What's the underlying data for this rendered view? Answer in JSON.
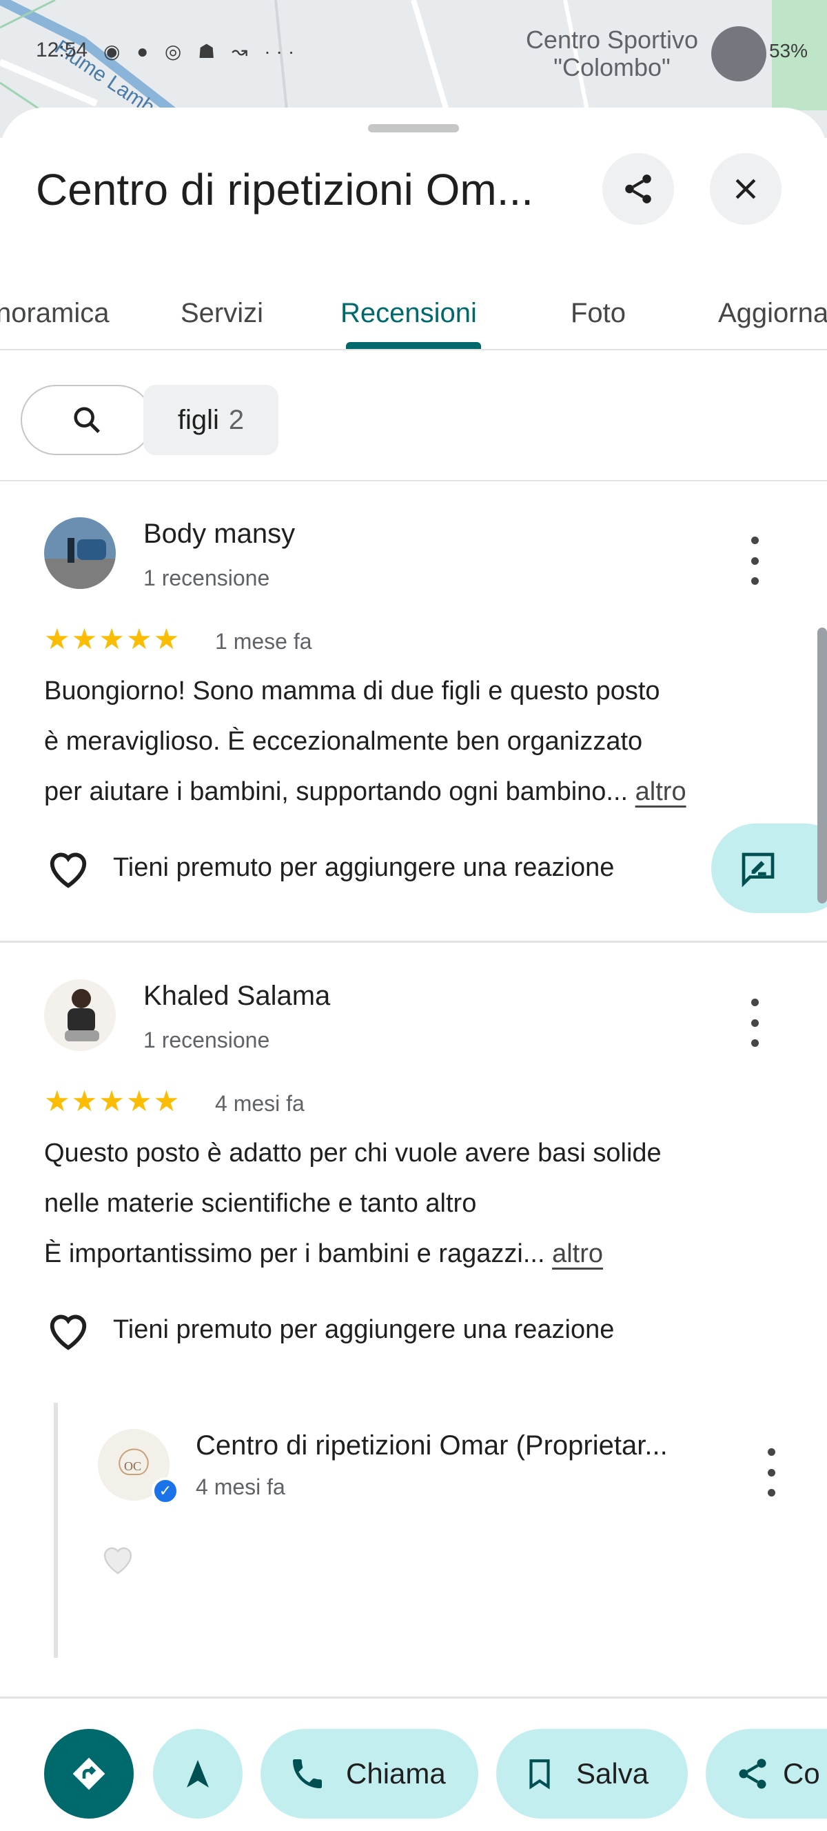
{
  "status_bar": {
    "time": "12:54",
    "notification_icons": "◉ ● ◎ ☗ ↝ ···",
    "battery": "53%"
  },
  "map": {
    "street_label": "Fiume Lamb",
    "place_label_line1": "Centro Sportivo",
    "place_label_line2": "\"Colombo\""
  },
  "header": {
    "title": "Centro di ripetizioni Om...",
    "share_icon": "share-icon",
    "close_icon": "close-icon"
  },
  "tabs": [
    {
      "label": "noramica"
    },
    {
      "label": "Servizi"
    },
    {
      "label": "Recensioni",
      "active": true
    },
    {
      "label": "Foto"
    },
    {
      "label": "Aggiorna"
    }
  ],
  "filters": {
    "search_icon": "search-icon",
    "chip_label": "figli",
    "chip_count": "2"
  },
  "reviews": [
    {
      "author": "Body mansy",
      "meta": "1 recensione",
      "rating": 5,
      "stars": "★★★★★",
      "when": "1 mese fa",
      "lines": [
        "Buongiorno! Sono mamma di due figli e questo posto",
        "è meraviglioso. È eccezionalmente ben organizzato",
        "per aiutare i bambini, supportando ogni bambino... "
      ],
      "more": "altro",
      "reaction": "Tieni premuto per aggiungere una reazione"
    },
    {
      "author": "Khaled Salama",
      "meta": "1 recensione",
      "rating": 5,
      "stars": "★★★★★",
      "when": "4 mesi fa",
      "lines": [
        "Questo posto è adatto per chi vuole avere basi solide",
        "nelle materie scientifiche e tanto altro",
        "È importantissimo per i bambini e ragazzi... "
      ],
      "more": "altro",
      "reaction": "Tieni premuto per aggiungere una reazione"
    }
  ],
  "owner_reply": {
    "name": "Centro di ripetizioni Omar (Proprietar...",
    "when": "4 mesi fa",
    "verified_icon": "verified-check-icon"
  },
  "bottom_actions": {
    "directions_icon": "directions-icon",
    "navigate_icon": "navigation-arrow-icon",
    "call": "Chiama",
    "save": "Salva",
    "share": "Co"
  },
  "colors": {
    "accent": "#00696b",
    "action_bg": "#c3eef0",
    "star": "#fbbc04",
    "verified": "#1a73e8"
  }
}
